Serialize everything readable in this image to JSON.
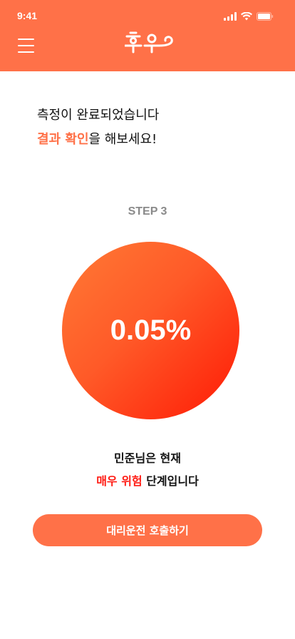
{
  "status_bar": {
    "time": "9:41",
    "icons": [
      "signal-icon",
      "wifi-icon",
      "battery-icon"
    ]
  },
  "header": {
    "menu_icon": "hamburger-menu-icon",
    "logo_text": "후우",
    "background": "#ff7148"
  },
  "message": {
    "line1": "측정이 완료되었습니다",
    "line2_accent": "결과 확인",
    "line2_rest": "을 해보세요!"
  },
  "step": {
    "label": "STEP 3"
  },
  "measurement": {
    "value": "0.05%"
  },
  "result": {
    "line1": "민준님은 현재",
    "level": "매우 위험",
    "line2_rest": " 단계입니다"
  },
  "cta": {
    "label": "대리운전 호출하기"
  },
  "colors": {
    "accent": "#ff7148",
    "danger": "#ff1a12",
    "step_gray": "#8a8a8a"
  }
}
